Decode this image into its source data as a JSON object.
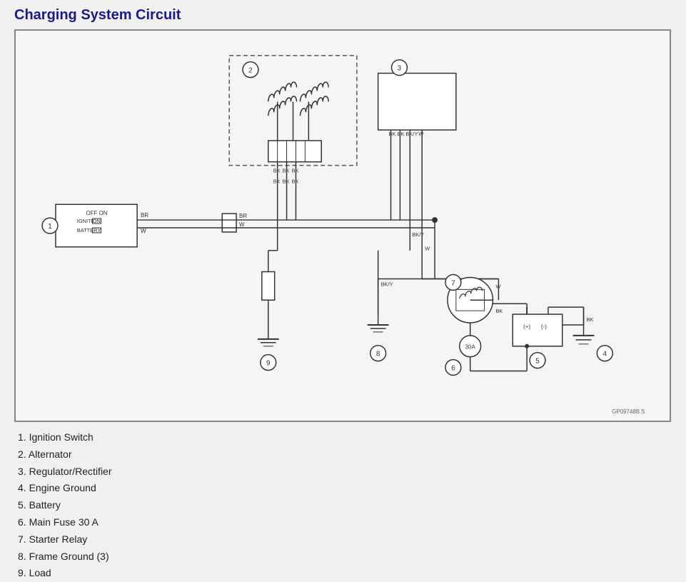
{
  "title": "Charging System Circuit",
  "legend": [
    "1. Ignition Switch",
    "2. Alternator",
    "3. Regulator/Rectifier",
    "4. Engine Ground",
    "5. Battery",
    "6. Main Fuse 30 A",
    "7. Starter Relay",
    "8. Frame Ground (3)",
    "9. Load"
  ],
  "watermark": "GP09748B  S"
}
